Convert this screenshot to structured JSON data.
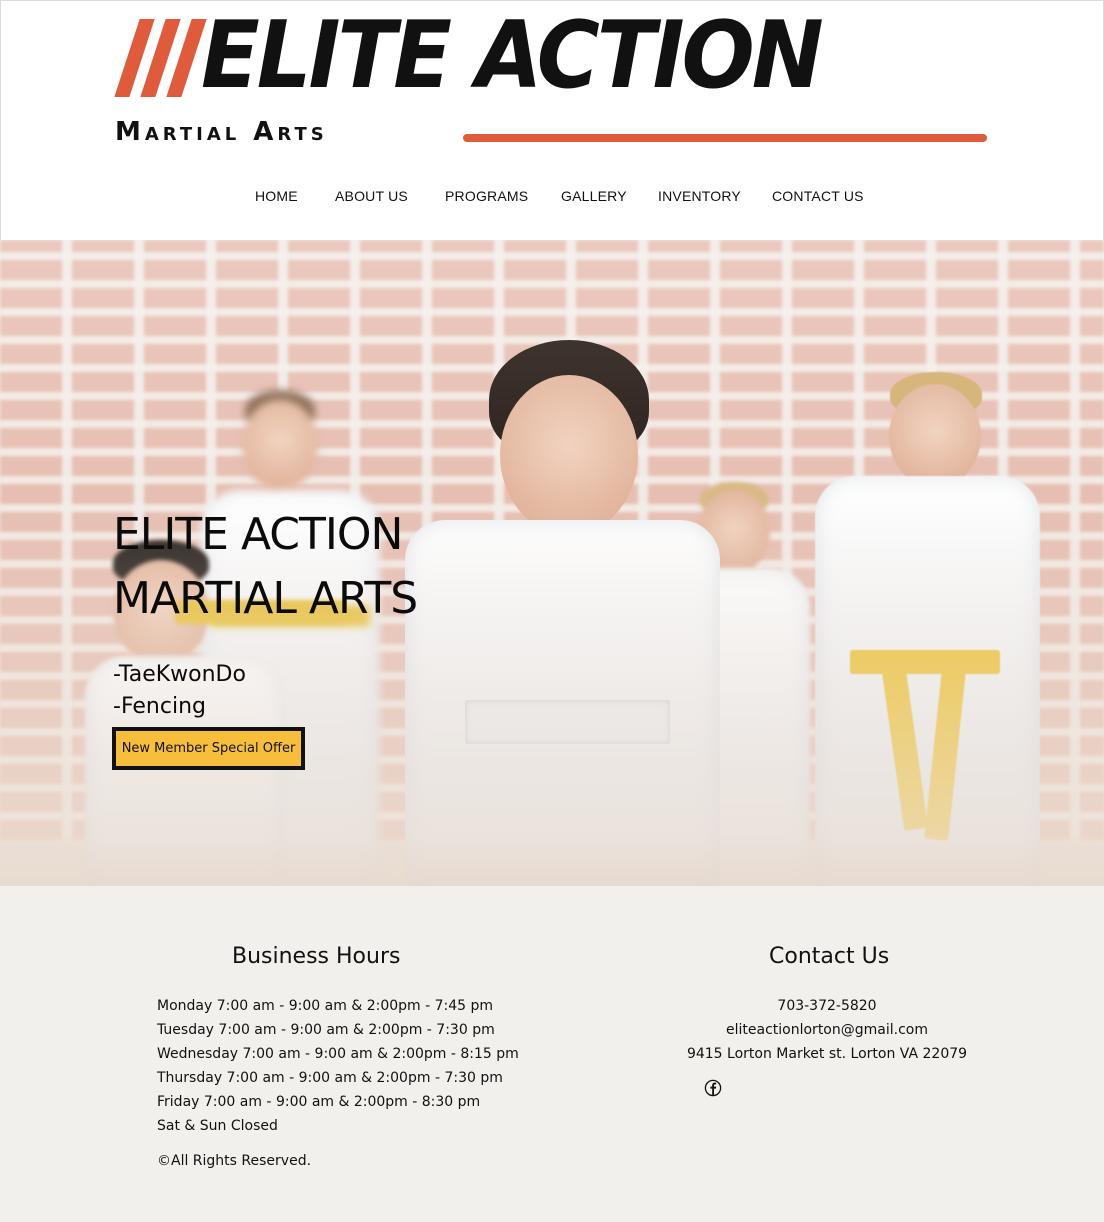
{
  "logo": {
    "main_text": "ELITE ACTION",
    "sub_text": "Martial Arts",
    "accent_color": "#e05a3c"
  },
  "nav": {
    "items": [
      {
        "label": "HOME"
      },
      {
        "label": "ABOUT US"
      },
      {
        "label": "PROGRAMS"
      },
      {
        "label": "GALLERY"
      },
      {
        "label": "INVENTORY"
      },
      {
        "label": "CONTACT US"
      }
    ]
  },
  "hero": {
    "title_line1": "ELITE ACTION",
    "title_line2": "MARTIAL ARTS",
    "programs": [
      "-TaeKwonDo",
      "-Fencing"
    ],
    "cta_label": "New Member Special Offer",
    "cta_color": "#f6be3a"
  },
  "footer": {
    "hours_heading": "Business Hours",
    "hours": [
      "Monday 7:00 am - 9:00 am & 2:00pm - 7:45 pm",
      "Tuesday 7:00 am - 9:00 am & 2:00pm - 7:30 pm",
      "Wednesday 7:00 am - 9:00 am & 2:00pm - 8:15 pm",
      "Thursday 7:00 am - 9:00 am & 2:00pm - 7:30 pm",
      "Friday 7:00 am - 9:00 am & 2:00pm - 8:30 pm",
      "Sat & Sun Closed"
    ],
    "copyright": "©All Rights Reserved.",
    "contact_heading": "Contact Us",
    "phone": "703-372-5820",
    "email": "eliteactionlorton@gmail.com",
    "address": "9415 Lorton Market st. Lorton VA 22079",
    "social_icon": "facebook-icon",
    "background_color": "#f1f0ec"
  }
}
